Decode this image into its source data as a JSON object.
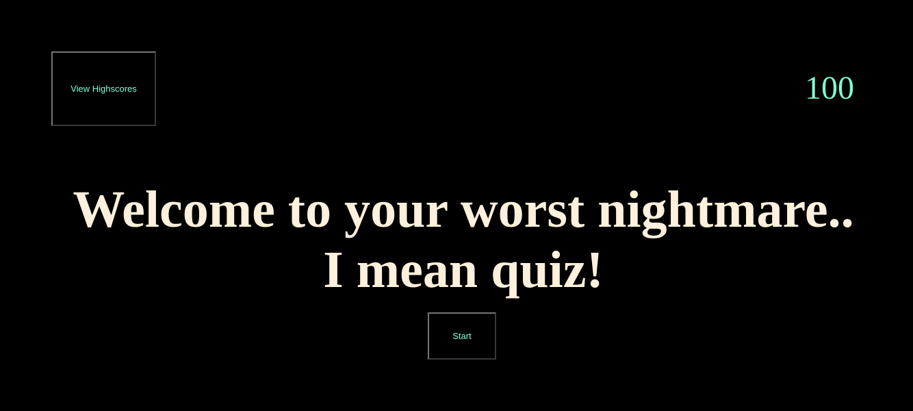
{
  "header": {
    "highscores_label": "View Highscores",
    "timer_value": "100"
  },
  "main": {
    "title_line1": "Welcome to your worst nightmare..",
    "title_line2": "I mean quiz!",
    "start_label": "Start"
  },
  "colors": {
    "background": "#000000",
    "accent": "#7fffd4",
    "title_text": "#fdf0dc"
  }
}
